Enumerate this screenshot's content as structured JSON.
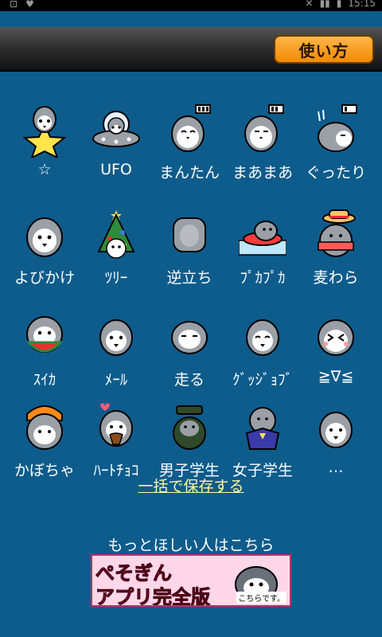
{
  "status_bar": {
    "time": "15:15"
  },
  "header": {
    "howto_label": "使い方"
  },
  "stickers": [
    [
      "☆",
      "UFO",
      "まんたん",
      "まあまあ",
      "ぐったり"
    ],
    [
      "よびかけ",
      "ﾂﾘｰ",
      "逆立ち",
      "ﾌﾟｶﾌﾟｶ",
      "麦わら"
    ],
    [
      "ｽｲｶ",
      "ﾒｰﾙ",
      "走る",
      "ｸﾞｯｼﾞｮﾌﾞ",
      "≧∇≦"
    ],
    [
      "かぼちゃ",
      "ﾊｰﾄﾁｮｺ",
      "男子学生",
      "女子学生",
      "…"
    ]
  ],
  "actions": {
    "save_all": "一括で保存する",
    "more_text": "もっとほしい人はこちら"
  },
  "banner": {
    "line1": "ぺそぎん",
    "line2": "アプリ完全版",
    "tag": "こちらです。"
  },
  "colors": {
    "background": "#0d5c8c",
    "accent": "#f08a00",
    "link": "#fff8a0"
  }
}
